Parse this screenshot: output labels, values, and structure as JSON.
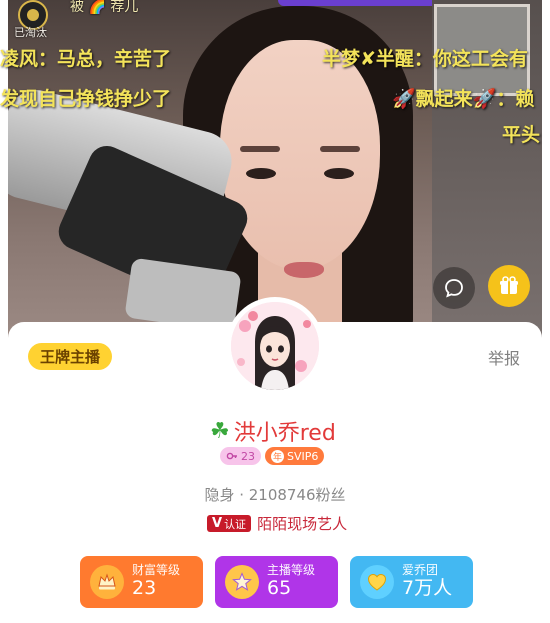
{
  "stream": {
    "rank_text": "已淘汰",
    "top_snippet": "被 🌈 荐儿",
    "danmaku": [
      "凌风：马总，辛苦了",
      "发现自己挣钱挣少了",
      "半梦✘半醒：你这工会有",
      "🚀飘起来🚀：赖",
      "平头"
    ],
    "chat_icon": "chat-bubble-icon",
    "gift_icon": "gift-icon"
  },
  "profile": {
    "tag": "王牌主播",
    "report": "举报",
    "name_prefix": "☘",
    "name": "洪小乔red",
    "badges": {
      "level": "23",
      "year_char": "年",
      "svip": "SVIP6"
    },
    "fans_line": "隐身 · 2108746粉丝",
    "verify_label": "认证",
    "verify_v": "V",
    "verify_text": "陌陌现场艺人"
  },
  "levels": [
    {
      "title": "财富等级",
      "value": "23",
      "icon": "wealth-crown-icon"
    },
    {
      "title": "主播等级",
      "value": "65",
      "icon": "star-medal-icon"
    },
    {
      "title": "爱乔团",
      "value": "7万人",
      "icon": "heart-gem-icon"
    }
  ],
  "colors": {
    "accent_gold": "#ffd231",
    "name_red": "#e23a3a",
    "wealth_orange": "#ff7a2f",
    "anchor_purple": "#b035e8",
    "fan_blue": "#43b8f2"
  }
}
